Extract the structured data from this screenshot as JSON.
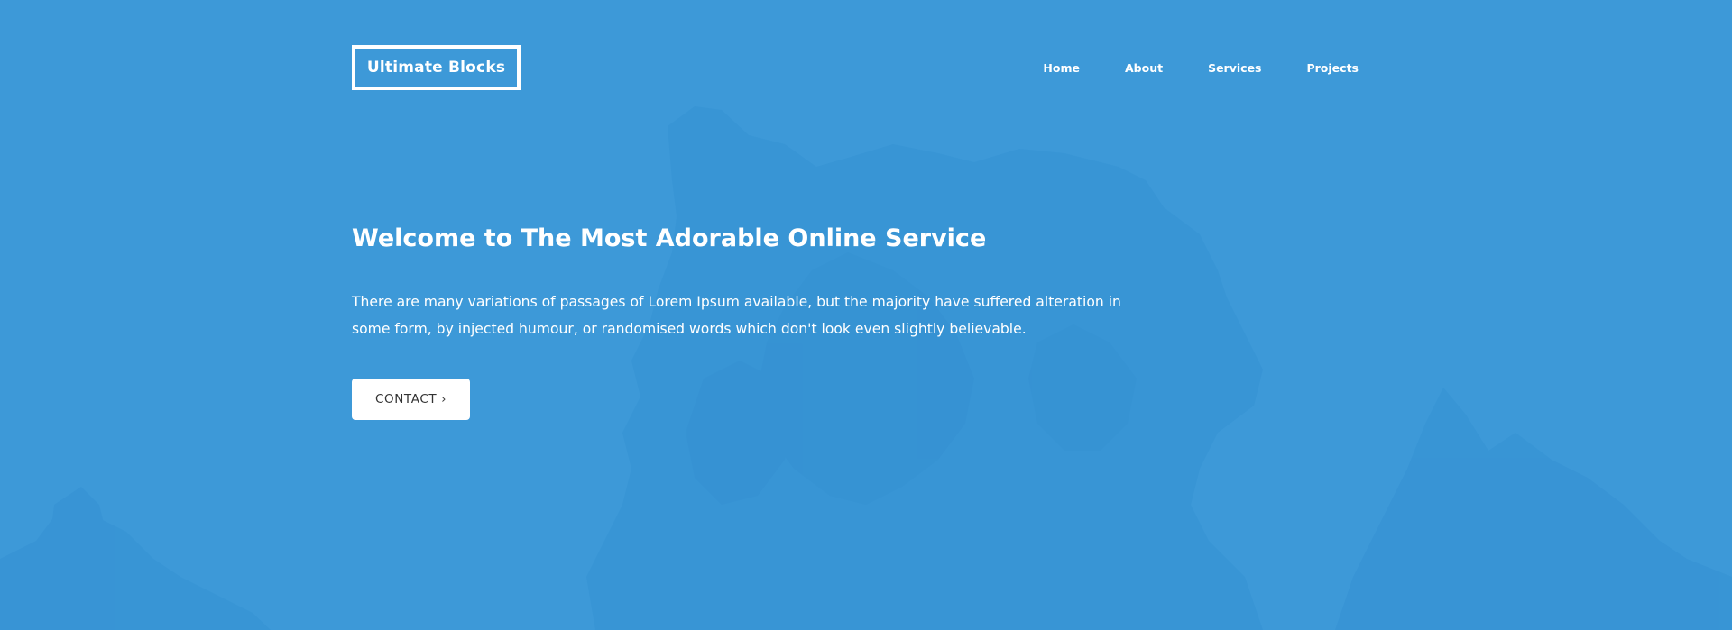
{
  "brand": {
    "logo_text": "Ultimate Blocks"
  },
  "nav": {
    "items": [
      {
        "label": "Home"
      },
      {
        "label": "About"
      },
      {
        "label": "Services"
      },
      {
        "label": "Projects"
      }
    ]
  },
  "hero": {
    "title": "Welcome to The Most Adorable Online Service",
    "description": "There are many variations of passages of Lorem Ipsum available, but the majority have suffered alteration in some form, by injected humour, or randomised words which don't look even slightly believable.",
    "cta_label": "CONTACT",
    "cta_icon": "chevron-right-icon"
  },
  "colors": {
    "background": "#3d99d8",
    "background_art": "#3490d2",
    "text": "#ffffff",
    "button_bg": "#ffffff",
    "button_text": "#333333"
  }
}
